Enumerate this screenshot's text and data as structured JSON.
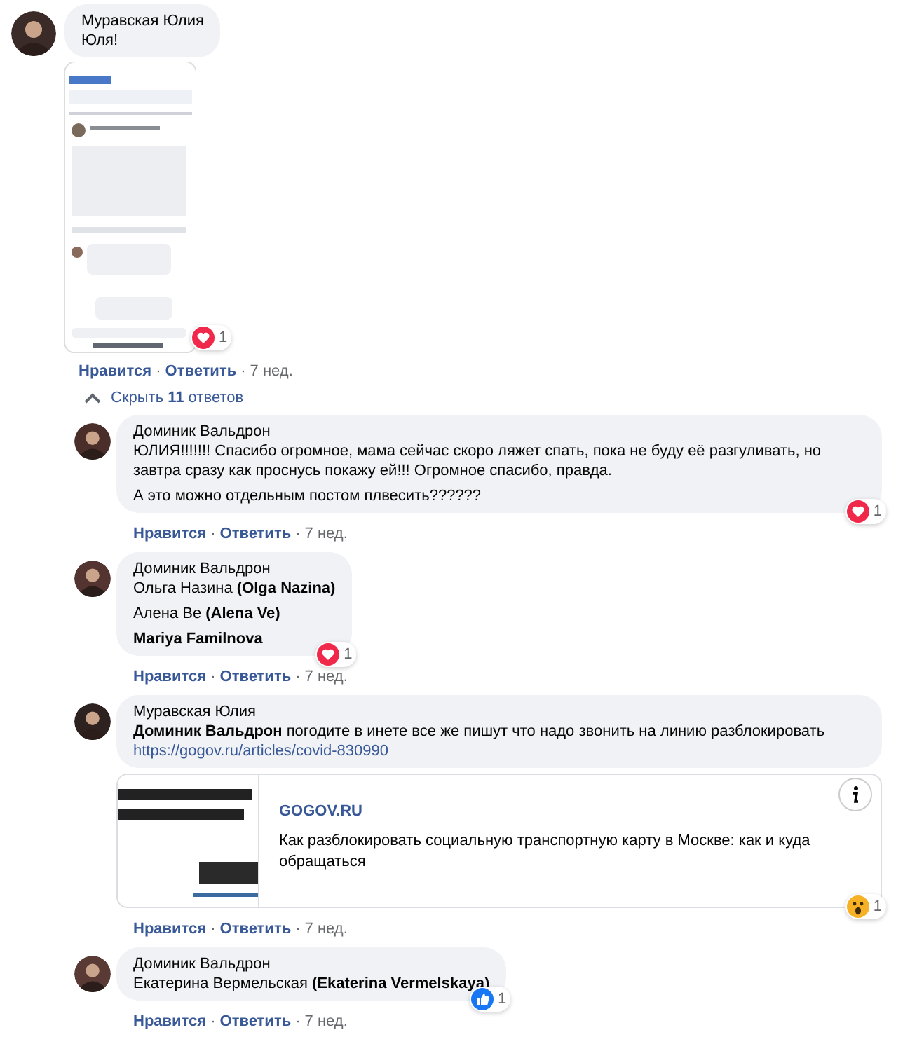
{
  "top_comment": {
    "author": "Муравская Юлия",
    "paragraphs": [
      {
        "kind": "text",
        "text": "Юля!"
      }
    ],
    "reaction": {
      "kind": "love",
      "count": "1"
    },
    "actions": {
      "like": "Нравится",
      "separator": "·",
      "reply": "Ответить",
      "time": "7 нед."
    }
  },
  "replies_toggle": {
    "label": "Скрыть **11** ответов",
    "expanded": true
  },
  "replies": [
    {
      "author": "Доминик Вальдрон",
      "paragraphs": [
        {
          "kind": "text",
          "text": "ЮЛИЯ!!!!!!! Спасибо огромное, мама сейчас скоро ляжет спать, пока не буду её разгуливать, но завтра сразу как проснусь покажу ей!!! Огромное спасибо, правда."
        },
        {
          "kind": "text",
          "text": "А это можно отдельным постом плвесить??????"
        }
      ],
      "reaction": {
        "kind": "love",
        "count": "1"
      },
      "actions": {
        "like": "Нравится",
        "separator": "·",
        "reply": "Ответить",
        "time": "7 нед."
      }
    },
    {
      "author": "Доминик Вальдрон",
      "paragraphs": [
        {
          "kind": "text",
          "text": "Ольга Назина **(Olga Nazina)**"
        },
        {
          "kind": "text",
          "text": "Алена Ве **(Alena Ve)**"
        },
        {
          "kind": "text",
          "text": "Mariya Familnova",
          "bold": true
        }
      ],
      "reaction": {
        "kind": "love",
        "count": "1"
      },
      "actions": {
        "like": "Нравится",
        "separator": "·",
        "reply": "Ответить",
        "time": "7 нед."
      }
    },
    {
      "author": "Муравская Юлия",
      "paragraphs": [
        {
          "kind": "text",
          "text": "**Доминик Вальдрон** погодите в инете все же пишут что надо звонить на линию разблокировать"
        },
        {
          "kind": "link",
          "text": "https://gogov.ru/articles/covid-830990"
        }
      ],
      "preview": {
        "domain": "GOGOV.RU",
        "title": "Как разблокировать социальную транспортную карту в Москве: как и куда обращаться"
      },
      "reaction": {
        "kind": "wow",
        "count": "1"
      },
      "actions": {
        "like": "Нравится",
        "separator": "·",
        "reply": "Ответить",
        "time": "7 нед."
      }
    },
    {
      "author": "Доминик Вальдрон",
      "paragraphs": [
        {
          "kind": "text",
          "text": "Екатерина Вермельская **(Ekaterina Vermelskaya)**"
        }
      ],
      "reaction": {
        "kind": "like",
        "count": "1"
      },
      "actions": {
        "like": "Нравится",
        "separator": "·",
        "reply": "Ответить",
        "time": "7 нед."
      }
    }
  ]
}
